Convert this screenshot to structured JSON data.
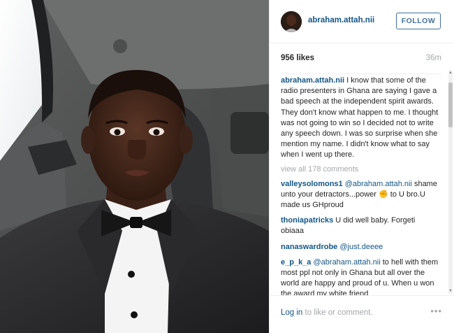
{
  "post": {
    "username": "abraham.attah.nii",
    "follow_label": "FOLLOW",
    "likes": "956 likes",
    "time_ago": "36m"
  },
  "caption": {
    "username": "abraham.attah.nii",
    "text": " I know that some of the radio presenters in Ghana are saying I gave a bad speech at the independent spirit awards. They don't know what happen to me. I thought was not going to win so I decided not to write any speech down. I was so surprise when she mention my name. I didn't know what to say when I went up there."
  },
  "view_all": "view all 178 comments",
  "comments": [
    {
      "username": "valleysolomons1",
      "mention": "@abraham.attah.nii",
      "text": " shame unto your detractors...power ✊ to U bro.U made us GHproud"
    },
    {
      "username": "thoniapatricks",
      "mention": "",
      "text": " U did well baby. Forgeti obiaaa"
    },
    {
      "username": "nanaswardrobe",
      "mention": "@just.deeee",
      "text": ""
    },
    {
      "username": "e_p_k_a",
      "mention": "@abraham.attah.nii",
      "text": " to hell with them most ppl not only in Ghana but all over the world are happy and proud of u. When u won the award my white friend"
    }
  ],
  "footer": {
    "login": "Log in",
    "rest": " to like or comment.",
    "more": "•••"
  },
  "colors": {
    "username_blue": "#125688",
    "follow_blue": "#3f729b",
    "muted_gray": "#a5a7aa"
  }
}
